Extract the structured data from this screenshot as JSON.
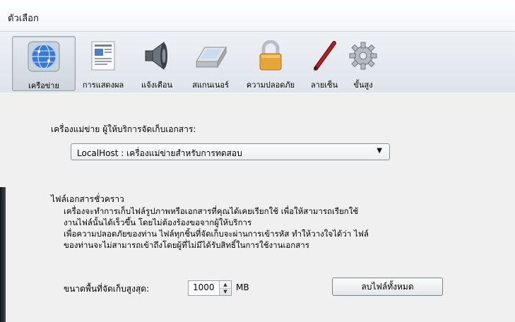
{
  "window": {
    "title": "ตัวเลือก"
  },
  "toolbar": {
    "tabs": [
      {
        "label": "เครือข่าย",
        "icon": "network-globe-icon",
        "selected": true
      },
      {
        "label": "การแสดงผล",
        "icon": "display-document-icon",
        "selected": false
      },
      {
        "label": "แจ้งเตือน",
        "icon": "speaker-icon",
        "selected": false
      },
      {
        "label": "สแกนเนอร์",
        "icon": "scanner-icon",
        "selected": false
      },
      {
        "label": "ความปลอดภัย",
        "icon": "padlock-icon",
        "selected": false
      },
      {
        "label": "ลายเซ็น",
        "icon": "pen-icon",
        "selected": false
      },
      {
        "label": "ขั้นสูง",
        "icon": "gear-icon",
        "selected": false
      }
    ]
  },
  "server": {
    "label": "เครื่องแม่ข่าย ผู้ให้บริการจัดเก็บเอกสาร:",
    "selected_value": "LocalHost : เครื่องแม่ข่ายสำหรับการทดสอบ"
  },
  "temp_files": {
    "heading": "ไฟล์เอกสารชั่วคราว",
    "description_lines": [
      "เครื่องจะทำการเก็บไฟล์รูปภาพหรือเอกสารที่คุณได้เคยเรียกใช้ เพื่อให้สามารถเรียกใช้",
      "งานไฟล์นั้นได้เร็วขึ้น โดยไม่ต้องร้องขอจากผู้ให้บริการ",
      "เพื่อความปลอดภัยของท่าน ไฟล์ทุกชิ้นที่จัดเก็บจะผ่านการเข้ารหัส ทำให้วางใจได้ว่า ไฟล์",
      "ของท่านจะไม่สามารถเข้าถึงโดยผู้ที่ไม่มีได้รับสิทธิ์ในการใช้งานเอกสาร"
    ],
    "max_size_label": "ขนาดพื้นที่จัดเก็บสูงสุด:",
    "max_size_value": "1000",
    "unit": "MB",
    "delete_all_label": "ลบไฟล์ทั้งหมด"
  }
}
